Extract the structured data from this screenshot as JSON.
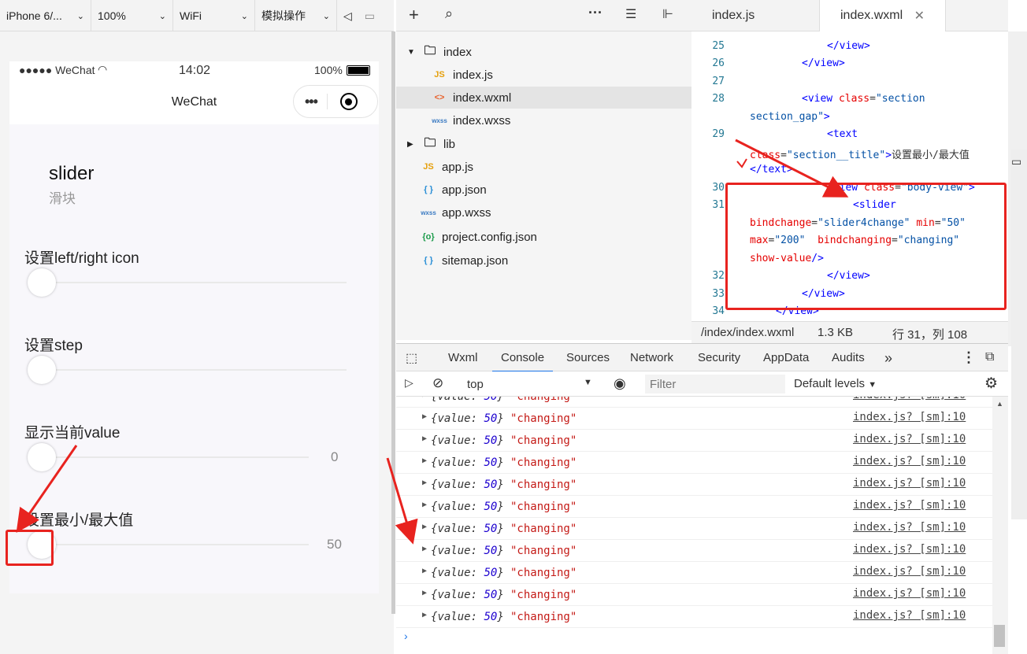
{
  "simulator": {
    "toolbar": {
      "device": "iPhone 6/...",
      "zoom": "100%",
      "network": "WiFi",
      "mode": "模拟操作"
    },
    "status_bar": {
      "signal": "●●●●● WeChat",
      "time": "14:02",
      "battery": "100%"
    },
    "nav_title": "WeChat",
    "page": {
      "title": "slider",
      "subtitle": "滑块",
      "sections": [
        {
          "label": "设置left/right icon",
          "value": "",
          "level": 0
        },
        {
          "label": "设置step",
          "value": "",
          "level": 0
        },
        {
          "label": "显示当前value",
          "value": "0",
          "level": 0
        },
        {
          "label": "设置最小/最大值",
          "value": "50",
          "level": 0
        }
      ]
    }
  },
  "file_tree": {
    "items": [
      {
        "name": "index",
        "icon": "folder-open-icon",
        "glyph": "▼"
      },
      {
        "name": "index.js",
        "icon": "js-file-icon",
        "glyph": "JS"
      },
      {
        "name": "index.wxml",
        "icon": "wxml-file-icon",
        "glyph": "<>"
      },
      {
        "name": "index.wxss",
        "icon": "wxss-file-icon",
        "glyph": "wxss"
      },
      {
        "name": "lib",
        "icon": "folder-icon",
        "glyph": "▶"
      },
      {
        "name": "app.js",
        "icon": "js-file-icon",
        "glyph": "JS"
      },
      {
        "name": "app.json",
        "icon": "json-file-icon",
        "glyph": "{ }"
      },
      {
        "name": "app.wxss",
        "icon": "wxss-file-icon",
        "glyph": "wxss"
      },
      {
        "name": "project.config.json",
        "icon": "config-file-icon",
        "glyph": "{o}"
      },
      {
        "name": "sitemap.json",
        "icon": "json-file-icon",
        "glyph": "{ }"
      }
    ]
  },
  "editor": {
    "tabs": [
      "index.js",
      "index.wxml"
    ],
    "status": {
      "path": "/index/index.wxml",
      "size": "1.3 KB",
      "cursor": "行 31，列 108"
    },
    "line_numbers": [
      "25",
      "26",
      "27",
      "28",
      "29",
      "30",
      "31",
      "32",
      "33",
      "34"
    ]
  },
  "devtools": {
    "tabs": [
      "Wxml",
      "Console",
      "Sources",
      "Network",
      "Security",
      "AppData",
      "Audits"
    ],
    "more": "»",
    "context": "top",
    "filter_placeholder": "Filter",
    "levels": "Default levels",
    "log_value_key": "value:",
    "log_value": "50",
    "log_string": "\"changing\"",
    "log_source": "index.js? [sm]:10",
    "log_count": 11
  },
  "colors": {
    "accent": "#1a73e8",
    "annotation": "#e8231f",
    "code_tag": "#800000",
    "code_attr": "#e50000",
    "code_value": "#0451a5"
  }
}
